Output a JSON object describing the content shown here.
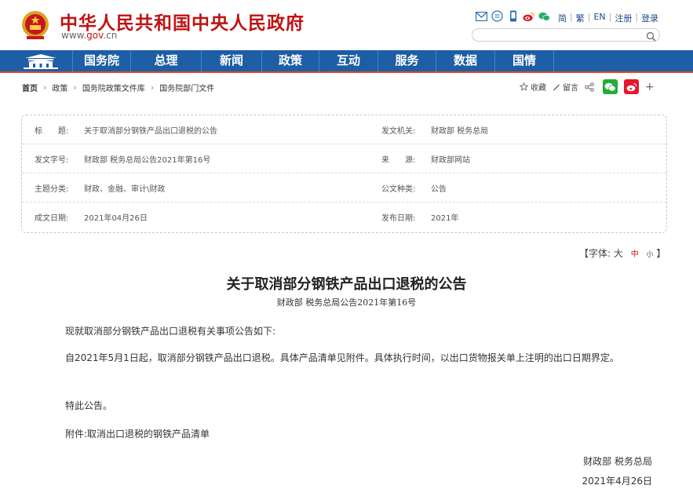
{
  "header": {
    "site_name": "中华人民共和国中央人民政府",
    "site_url_prefix": "www.",
    "site_url_brand": "gov",
    "site_url_suffix": ".cn",
    "search_placeholder": "",
    "top_icons": [
      "mail-icon",
      "message-icon",
      "mobile-icon",
      "weibo-icon",
      "wechat-icon"
    ],
    "top_links": [
      "简",
      "繁",
      "EN",
      "注册",
      "登录"
    ],
    "brand_color": "#c01313"
  },
  "nav": {
    "bg_color": "#1d5ea5",
    "items": [
      "国务院",
      "总理",
      "新闻",
      "政策",
      "互动",
      "服务",
      "数据",
      "国情"
    ]
  },
  "breadcrumb": {
    "items": [
      "首页",
      "政策",
      "国务院政策文件库",
      "国务院部门文件"
    ]
  },
  "share": {
    "favorite": "收藏",
    "comment": "留言"
  },
  "info": {
    "rows": [
      {
        "l1": "标　　题:",
        "v1": "关于取消部分钢铁产品出口退税的公告",
        "l2": "发文机关:",
        "v2": "财政部  税务总局"
      },
      {
        "l1": "发文字号:",
        "v1": "财政部  税务总局公告2021年第16号",
        "l2": "来　　源:",
        "v2": "财政部网站"
      },
      {
        "l1": "主题分类:",
        "v1": "财政、金融、审计\\财政",
        "l2": "公文种类:",
        "v2": "公告"
      },
      {
        "l1": "成文日期:",
        "v1": "2021年04月26日",
        "l2": "发布日期:",
        "v2": "2021年"
      }
    ]
  },
  "fontsize": {
    "open": "【字体:",
    "large": "大",
    "medium": "中",
    "small": "小",
    "close": "】"
  },
  "article": {
    "title": "关于取消部分钢铁产品出口退税的公告",
    "subtitle": "财政部  税务总局公告2021年第16号",
    "p1": "现就取消部分钢铁产品出口退税有关事项公告如下:",
    "p2": "自2021年5月1日起，取消部分钢铁产品出口退税。具体产品清单见附件。具体执行时间，以出口货物报关单上注明的出口日期界定。",
    "p3": "特此公告。",
    "p4": "附件:取消出口退税的钢铁产品清单",
    "sign_org": "财政部  税务总局",
    "sign_date": "2021年4月26日"
  }
}
